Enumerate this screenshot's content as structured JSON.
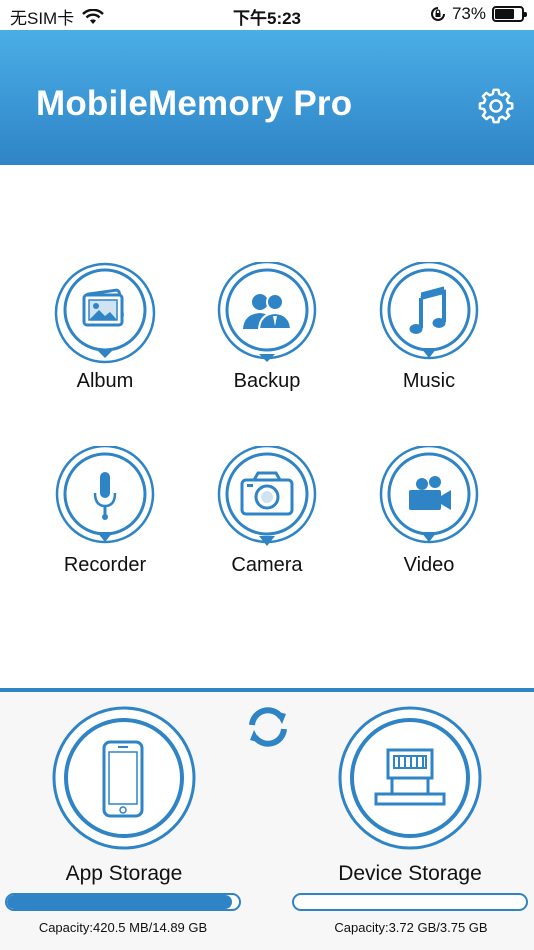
{
  "status_bar": {
    "carrier": "无SIM卡",
    "time": "下午5:23",
    "battery_percent": "73%",
    "battery_level": 0.73
  },
  "header": {
    "title": "MobileMemory Pro",
    "settings_icon": "gear-icon"
  },
  "features": [
    {
      "label": "Album",
      "icon": "album-icon"
    },
    {
      "label": "Backup",
      "icon": "backup-icon"
    },
    {
      "label": "Music",
      "icon": "music-icon"
    },
    {
      "label": "Recorder",
      "icon": "microphone-icon"
    },
    {
      "label": "Camera",
      "icon": "camera-icon"
    },
    {
      "label": "Video",
      "icon": "video-camera-icon"
    }
  ],
  "storage": {
    "refresh_icon": "refresh-icon",
    "app": {
      "label": "App Storage",
      "capacity": "Capacity:420.5 MB/14.89 GB",
      "fill": 0.97,
      "icon": "phone-icon"
    },
    "device": {
      "label": "Device Storage",
      "capacity": "Capacity:3.72 GB/3.75 GB",
      "fill": 0.0,
      "icon": "lightning-connector-icon"
    }
  },
  "colors": {
    "accent": "#2f84c6",
    "header_top": "#4aaee6",
    "background": "#ffffff"
  }
}
